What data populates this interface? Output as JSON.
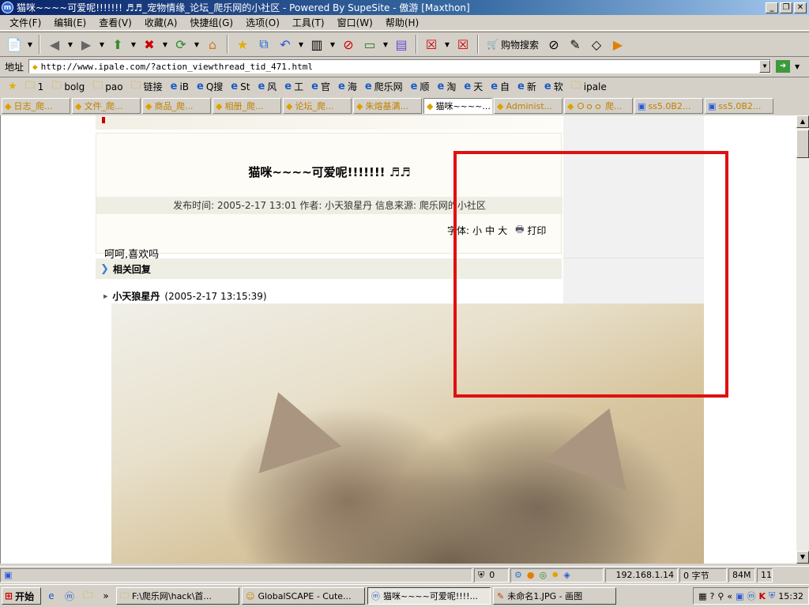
{
  "window": {
    "title": "猫咪~~~~可爱呢!!!!!!! ♬♬_宠物情缘_论坛_爬乐网的小社区 - Powered By SupeSite - 傲游 [Maxthon]",
    "app_icon": "m"
  },
  "menu": [
    "文件(F)",
    "编辑(E)",
    "查看(V)",
    "收藏(A)",
    "快捷组(G)",
    "选项(O)",
    "工具(T)",
    "窗口(W)",
    "帮助(H)"
  ],
  "toolbar": {
    "shop_label": "购物搜索"
  },
  "address": {
    "label": "地址",
    "url": "http://www.ipale.com/?action_viewthread_tid_471.html"
  },
  "favorites": [
    {
      "icon": "star-icon",
      "label": ""
    },
    {
      "icon": "folder-icon",
      "label": "1"
    },
    {
      "icon": "folder-icon",
      "label": "bolg"
    },
    {
      "icon": "folder-icon",
      "label": "pao"
    },
    {
      "icon": "folder-icon",
      "label": "链接"
    },
    {
      "icon": "ie-icon",
      "label": "iB"
    },
    {
      "icon": "ie-icon",
      "label": "Q搜"
    },
    {
      "icon": "ie-icon",
      "label": "St"
    },
    {
      "icon": "ie-icon",
      "label": "风"
    },
    {
      "icon": "ie-icon",
      "label": "工"
    },
    {
      "icon": "ie-icon",
      "label": "官"
    },
    {
      "icon": "ie-icon",
      "label": "海"
    },
    {
      "icon": "ie-icon",
      "label": "爬乐网"
    },
    {
      "icon": "ie-icon",
      "label": "顺"
    },
    {
      "icon": "ie-icon",
      "label": "淘"
    },
    {
      "icon": "ie-icon",
      "label": "天"
    },
    {
      "icon": "ie-icon",
      "label": "自"
    },
    {
      "icon": "ie-icon",
      "label": "新"
    },
    {
      "icon": "ie-icon",
      "label": "软"
    },
    {
      "icon": "folder-icon",
      "label": "ipale"
    }
  ],
  "tabs": [
    {
      "label": "日志_爬...",
      "active": false
    },
    {
      "label": "文件_爬...",
      "active": false
    },
    {
      "label": "商品_爬...",
      "active": false
    },
    {
      "label": "相册_爬...",
      "active": false
    },
    {
      "label": "论坛_爬...",
      "active": false
    },
    {
      "label": "朱熔基满...",
      "active": false
    },
    {
      "label": "猫咪~~~~...",
      "active": true
    },
    {
      "label": "Administ...",
      "active": false
    },
    {
      "label": "Ｏｏｏ 爬...",
      "active": false
    },
    {
      "label": "ss5.0B2...",
      "active": false
    },
    {
      "label": "ss5.0B2...",
      "active": false
    }
  ],
  "post": {
    "title": "猫咪~~~~可爱呢!!!!!!! ♬♬",
    "meta": "发布时间: 2005-2-17 13:01    作者: 小天狼星丹    信息来源: 爬乐网的小社区",
    "font_label": "字体:",
    "font_small": "小",
    "font_medium": "中",
    "font_large": "大",
    "print_label": "打印",
    "body": "呵呵,喜欢吗"
  },
  "replies": {
    "heading": "相关回复",
    "author": "小天狼星丹",
    "time": "(2005-2-17 13:15:39)"
  },
  "statusbar": {
    "count": "0",
    "ip": "192.168.1.14",
    "bytes": "0 字节",
    "mem": "84M",
    "extra": "11"
  },
  "taskbar": {
    "start": "开始",
    "tasks": [
      {
        "label": "F:\\爬乐网\\hack\\首...",
        "icon": "folder-icon",
        "active": false
      },
      {
        "label": "GlobalSCAPE - Cute...",
        "icon": "ftp-icon",
        "active": false
      },
      {
        "label": "猫咪~~~~可爱呢!!!!...",
        "icon": "maxthon-icon",
        "active": true
      },
      {
        "label": "未命名1.JPG - 画图",
        "icon": "paint-icon",
        "active": false
      }
    ],
    "clock": "15:32"
  },
  "colors": {
    "highlight_box": "#e01010",
    "titlebar": "#0a246a"
  }
}
